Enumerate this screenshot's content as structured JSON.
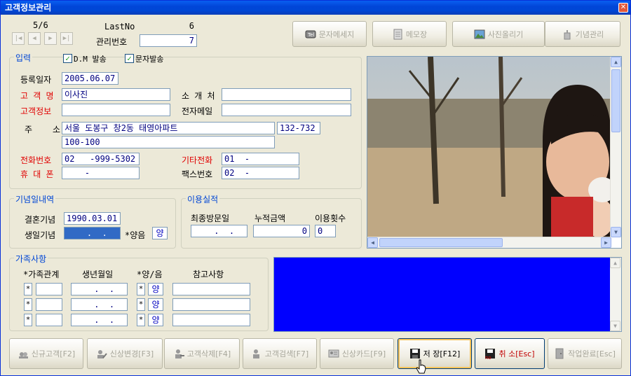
{
  "window": {
    "title": "고객정보관리",
    "close": "✕"
  },
  "nav": {
    "page": "5/6",
    "lastno_label": "LastNo",
    "lastno": "6",
    "mgmt_label": "관리번호",
    "mgmt": "7"
  },
  "topbuttons": {
    "sms": "문자메세지",
    "memo": "메모장",
    "photo": "사진올리기",
    "anniv": "기념관리"
  },
  "input": {
    "title": "입력",
    "dm_label": "D.M 발송",
    "dm_checked": true,
    "sms_label": "문자발송",
    "sms_checked": true,
    "reg_date_label": "등록일자",
    "reg_date": "2005.06.07",
    "name_label": "고 객 명",
    "name": "이사진",
    "referrer_label": "소 개 처",
    "referrer": "",
    "info_label": "고객정보",
    "info": "",
    "email_label": "전자메일",
    "email": "",
    "addr_label": "주    소",
    "addr1": "서울 도봉구 창2동 태영아파트",
    "zip": "132-732",
    "addr2": "100-100",
    "phone_label": "전화번호",
    "phone": "02   -999-5302",
    "other_phone_label": "기타전화",
    "other_phone": "01  -",
    "mobile_label": "휴 대 폰",
    "mobile": "    -",
    "fax_label": "팩스번호",
    "fax": "02  -"
  },
  "anniversary": {
    "title": "기념일내역",
    "wedding_label": "결혼기념",
    "wedding": "1990.03.01",
    "birthday_label": "생일기념",
    "birthday": "    .  .",
    "solar_label": "*양음",
    "solar": "양"
  },
  "usage": {
    "title": "이용실적",
    "last_visit_label": "최종방문일",
    "last_visit": "  .  .",
    "total_label": "누적금액",
    "total": "0",
    "count_label": "이용횟수",
    "count": "0"
  },
  "family": {
    "title": "가족사항",
    "headers": [
      "*가족관계",
      "생년월일",
      "*양/음",
      "참고사항"
    ],
    "rows": [
      {
        "star": "*",
        "relation": "",
        "birth": "  .  .",
        "star2": "*",
        "solar": "양",
        "note": ""
      },
      {
        "star": "*",
        "relation": "",
        "birth": "  .  .",
        "star2": "*",
        "solar": "양",
        "note": ""
      },
      {
        "star": "*",
        "relation": "",
        "birth": "  .  .",
        "star2": "*",
        "solar": "양",
        "note": ""
      }
    ]
  },
  "bottombuttons": {
    "new": "신규고객[F2]",
    "modify": "신상변경[F3]",
    "delete": "고객삭제[F4]",
    "search": "고객검색[F7]",
    "card": "신상카드[F9]",
    "save": "저 장[F12]",
    "cancel": "취 소[Esc]",
    "done": "작업완료[Esc]"
  },
  "colors": {
    "accent": "#0046D5",
    "required_label": "#E00000",
    "memo_bg": "#0000FF"
  }
}
